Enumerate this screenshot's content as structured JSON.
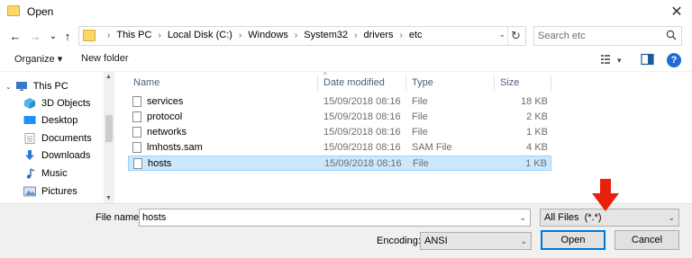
{
  "window": {
    "title": "Open",
    "close_glyph": "✕"
  },
  "nav": {
    "back": "←",
    "forward": "→",
    "dropdown": "⌄",
    "up": "↑"
  },
  "address": {
    "crumbs": [
      "This PC",
      "Local Disk (C:)",
      "Windows",
      "System32",
      "drivers",
      "etc"
    ],
    "separator": "›",
    "dropdown_glyph": "⌄",
    "refresh_glyph": "↻"
  },
  "search": {
    "placeholder": "Search etc",
    "icon": "search-icon"
  },
  "toolbar": {
    "organize_label": "Organize ▾",
    "new_folder_label": "New folder",
    "help_label": "?"
  },
  "sidebar": {
    "items": [
      {
        "label": "This PC",
        "icon": "computer-icon",
        "color": "#3b78c4"
      },
      {
        "label": "3D Objects",
        "icon": "cube-icon",
        "color": "#4fb6e8"
      },
      {
        "label": "Desktop",
        "icon": "desktop-icon",
        "color": "#1e90ff"
      },
      {
        "label": "Documents",
        "icon": "documents-icon",
        "color": "#9aa7b5"
      },
      {
        "label": "Downloads",
        "icon": "download-icon",
        "color": "#2a7bd6"
      },
      {
        "label": "Music",
        "icon": "music-icon",
        "color": "#3a6ea5"
      },
      {
        "label": "Pictures",
        "icon": "pictures-icon",
        "color": "#6a8fb8"
      }
    ]
  },
  "columns": {
    "name": "Name",
    "date": "Date modified",
    "type": "Type",
    "size": "Size",
    "sort_glyph": "^"
  },
  "files": [
    {
      "name": "services",
      "date": "15/09/2018 08:16",
      "type": "File",
      "size": "18 KB",
      "selected": false
    },
    {
      "name": "protocol",
      "date": "15/09/2018 08:16",
      "type": "File",
      "size": "2 KB",
      "selected": false
    },
    {
      "name": "networks",
      "date": "15/09/2018 08:16",
      "type": "File",
      "size": "1 KB",
      "selected": false
    },
    {
      "name": "lmhosts.sam",
      "date": "15/09/2018 08:16",
      "type": "SAM File",
      "size": "4 KB",
      "selected": false
    },
    {
      "name": "hosts",
      "date": "15/09/2018 08:16",
      "type": "File",
      "size": "1 KB",
      "selected": true
    }
  ],
  "footer": {
    "filename_label": "File name:",
    "filename_value": "hosts",
    "filter_value": "All Files  (*.*)",
    "encoding_label": "Encoding:",
    "encoding_value": "ANSI",
    "open_label": "Open",
    "cancel_label": "Cancel"
  },
  "colors": {
    "selection_bg": "#cce8ff",
    "selection_border": "#99d1ff",
    "accent": "#0078d7",
    "annotation_arrow": "#e8210b"
  }
}
